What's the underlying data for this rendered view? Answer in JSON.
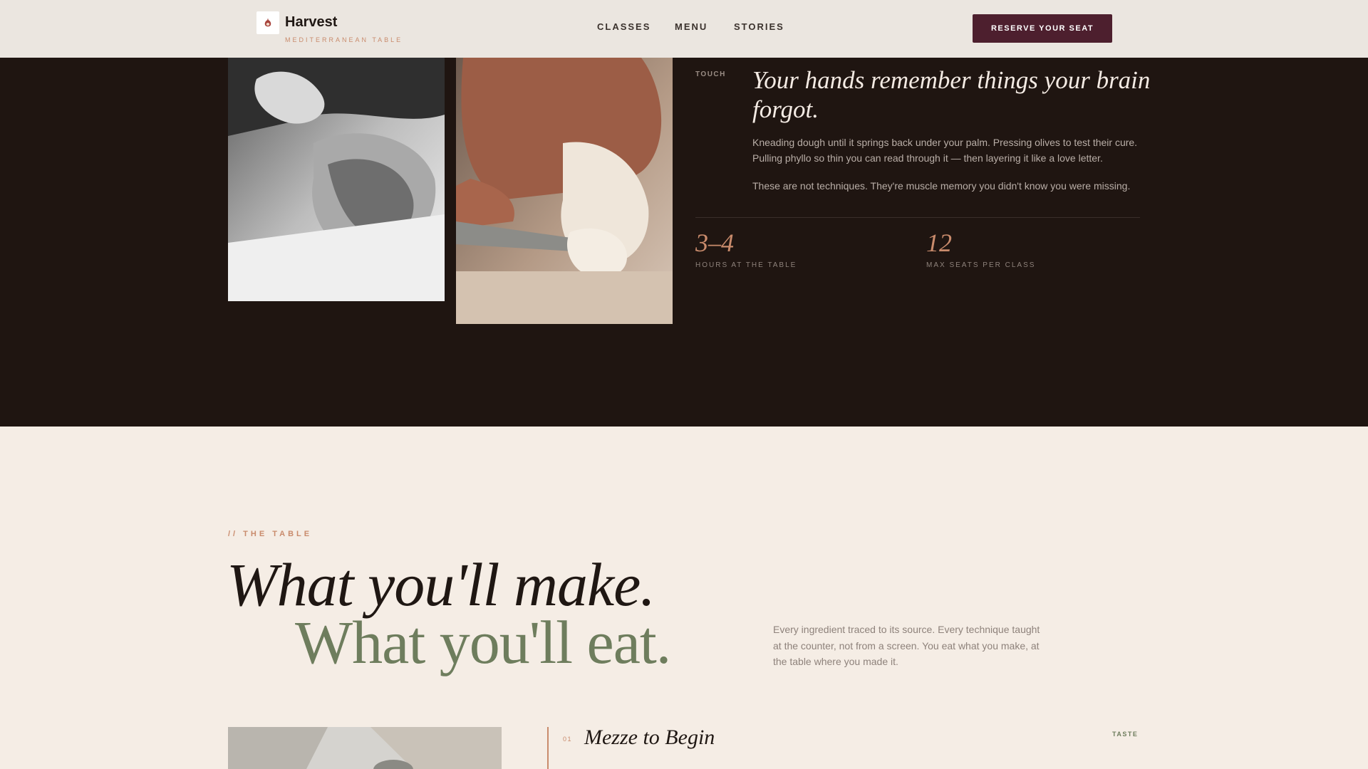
{
  "header": {
    "brand_name": "Harvest",
    "brand_tagline": "MEDITERRANEAN TABLE",
    "nav": [
      {
        "label": "CLASSES"
      },
      {
        "label": "MENU"
      },
      {
        "label": "STORIES"
      }
    ],
    "cta_label": "RESERVE YOUR SEAT"
  },
  "touch": {
    "eyebrow": "TOUCH",
    "title": "Your hands remember things your brain forgot.",
    "paragraph_1": "Kneading dough until it springs back under your palm. Pressing olives to test their cure. Pulling phyllo so thin you can read through it — then layering it like a love letter.",
    "paragraph_2": "These are not techniques. They're muscle memory you didn't know you were missing.",
    "stats": [
      {
        "value": "3–4",
        "label": "HOURS AT THE TABLE"
      },
      {
        "value": "12",
        "label": "MAX SEATS PER CLASS"
      }
    ]
  },
  "table": {
    "eyebrow": "// THE TABLE",
    "heading_line_1": "What you'll make.",
    "heading_line_2": "What you'll eat.",
    "description": "Every ingredient traced to its source. Every technique taught at the counter, not from a screen. You eat what you make, at the table where you made it.",
    "course": {
      "number": "01",
      "title": "Mezze to Begin",
      "tag": "TASTE"
    }
  },
  "colors": {
    "accent_terracotta": "#c98b6c",
    "cta_burgundy": "#4d1f2e",
    "olive_green": "#6e7d5d",
    "dark_background": "#1f1511",
    "cream_background": "#f5ede5"
  }
}
